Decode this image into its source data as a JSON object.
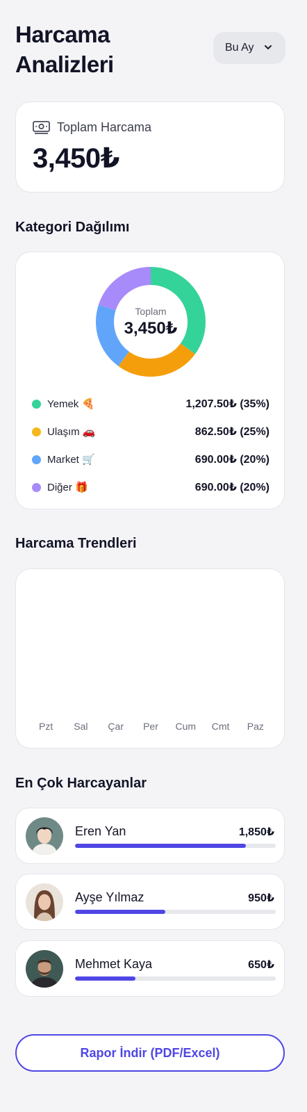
{
  "header": {
    "title": "Harcama Analizleri",
    "period": "Bu Ay"
  },
  "total": {
    "label": "Toplam Harcama",
    "value": "3,450₺",
    "icon": "money-icon"
  },
  "categories": {
    "title": "Kategori Dağılımı",
    "center_label": "Toplam",
    "center_value": "3,450₺",
    "items": [
      {
        "name": "Yemek 🍕",
        "value": "1,207.50₺ (35%)",
        "percent": 35,
        "color": "#34d399"
      },
      {
        "name": "Ulaşım 🚗",
        "value": "862.50₺ (25%)",
        "percent": 25,
        "color": "#f59e0b"
      },
      {
        "name": "Market 🛒",
        "value": "690.00₺ (20%)",
        "percent": 20,
        "color": "#60a5fa"
      },
      {
        "name": "Diğer 🎁",
        "value": "690.00₺ (20%)",
        "percent": 20,
        "color": "#a78bfa"
      }
    ]
  },
  "trends": {
    "title": "Harcama Trendleri",
    "days": [
      "Pzt",
      "Sal",
      "Çar",
      "Per",
      "Cum",
      "Cmt",
      "Paz"
    ]
  },
  "top_spenders": {
    "title": "En Çok Harcayanlar",
    "people": [
      {
        "name": "Eren Yan",
        "amount": "1,850₺",
        "progress": 0.85
      },
      {
        "name": "Ayşe Yılmaz",
        "amount": "950₺",
        "progress": 0.45
      },
      {
        "name": "Mehmet Kaya",
        "amount": "650₺",
        "progress": 0.3
      }
    ]
  },
  "report_button": "Rapor İndir (PDF/Excel)"
}
